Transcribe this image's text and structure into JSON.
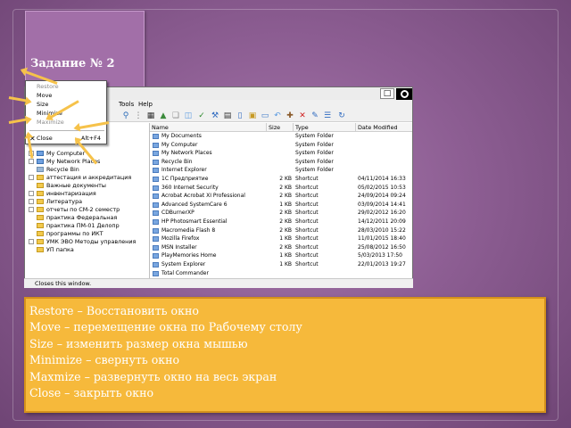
{
  "slide": {
    "title": "Задание № 2"
  },
  "window": {
    "menu": [
      "Tools",
      "Help"
    ],
    "status_text": "Closes this window."
  },
  "system_menu": {
    "items": [
      {
        "label": "Restore",
        "enabled": false
      },
      {
        "label": "Move",
        "enabled": true
      },
      {
        "label": "Size",
        "enabled": true
      },
      {
        "label": "Minimize",
        "enabled": true
      },
      {
        "label": "Maximize",
        "enabled": false
      },
      {
        "label": "Close",
        "shortcut": "Alt+F4",
        "enabled": true
      }
    ]
  },
  "tree": {
    "items": [
      "My Computer",
      "My Network Places",
      "Recycle Bin",
      "аттестация и аккредитация",
      "Важные документы",
      "инвентаризация",
      "Литература",
      "отчеты по СМ-2 семестр",
      "практика Федеральная",
      "практика ПМ-01 Делопр",
      "программы по ИКТ",
      "УМК ЭВО Методы управления",
      "УП папка"
    ]
  },
  "list": {
    "columns": [
      "Name",
      "Size",
      "Type",
      "Date Modified"
    ],
    "rows": [
      {
        "name": "My Documents",
        "size": "",
        "type": "System Folder",
        "date": ""
      },
      {
        "name": "My Computer",
        "size": "",
        "type": "System Folder",
        "date": ""
      },
      {
        "name": "My Network Places",
        "size": "",
        "type": "System Folder",
        "date": ""
      },
      {
        "name": "Recycle Bin",
        "size": "",
        "type": "System Folder",
        "date": ""
      },
      {
        "name": "Internet Explorer",
        "size": "",
        "type": "System Folder",
        "date": ""
      },
      {
        "name": "1С Предприятие",
        "size": "2 KB",
        "type": "Shortcut",
        "date": "04/11/2014 16:33"
      },
      {
        "name": "360 Internet Security",
        "size": "2 KB",
        "type": "Shortcut",
        "date": "05/02/2015 10:53"
      },
      {
        "name": "Acrobat Acrobat XI Professional",
        "size": "2 KB",
        "type": "Shortcut",
        "date": "24/09/2014 09:24"
      },
      {
        "name": "Advanced SystemCare 6",
        "size": "1 KB",
        "type": "Shortcut",
        "date": "03/09/2014 14:41"
      },
      {
        "name": "CDBurnerXP",
        "size": "2 KB",
        "type": "Shortcut",
        "date": "29/02/2012 16:20"
      },
      {
        "name": "HP Photosmart Essential",
        "size": "2 KB",
        "type": "Shortcut",
        "date": "14/12/2011 20:09"
      },
      {
        "name": "Macromedia Flash 8",
        "size": "2 KB",
        "type": "Shortcut",
        "date": "28/03/2010 15:22"
      },
      {
        "name": "Mozilla Firefox",
        "size": "1 KB",
        "type": "Shortcut",
        "date": "11/01/2015 18:40"
      },
      {
        "name": "MSN Installer",
        "size": "2 KB",
        "type": "Shortcut",
        "date": "25/08/2012 16:50"
      },
      {
        "name": "PlayMemories Home",
        "size": "1 KB",
        "type": "Shortcut",
        "date": "5/03/2013 17:50"
      },
      {
        "name": "System Explorer",
        "size": "1 KB",
        "type": "Shortcut",
        "date": "22/01/2013 19:27"
      },
      {
        "name": "Total Commander",
        "size": "",
        "type": "",
        "date": ""
      }
    ]
  },
  "info": {
    "lines": [
      "Restore – Восстановить окно",
      "Move – перемещение окна по Рабочему столу",
      "Size – изменить размер окна мышью",
      "Minimize – свернуть окно",
      "Maxmize – развернуть окно на весь экран",
      "Close – закрыть окно"
    ]
  },
  "colors": {
    "background": "#8d5e93",
    "title_tab": "#a26fa8",
    "info_box": "#f6b93b",
    "arrow": "#f6c24a"
  },
  "icons": [
    "window-close-icon",
    "folder-icon",
    "toolbar-icons",
    "system-menu-close-icon"
  ]
}
